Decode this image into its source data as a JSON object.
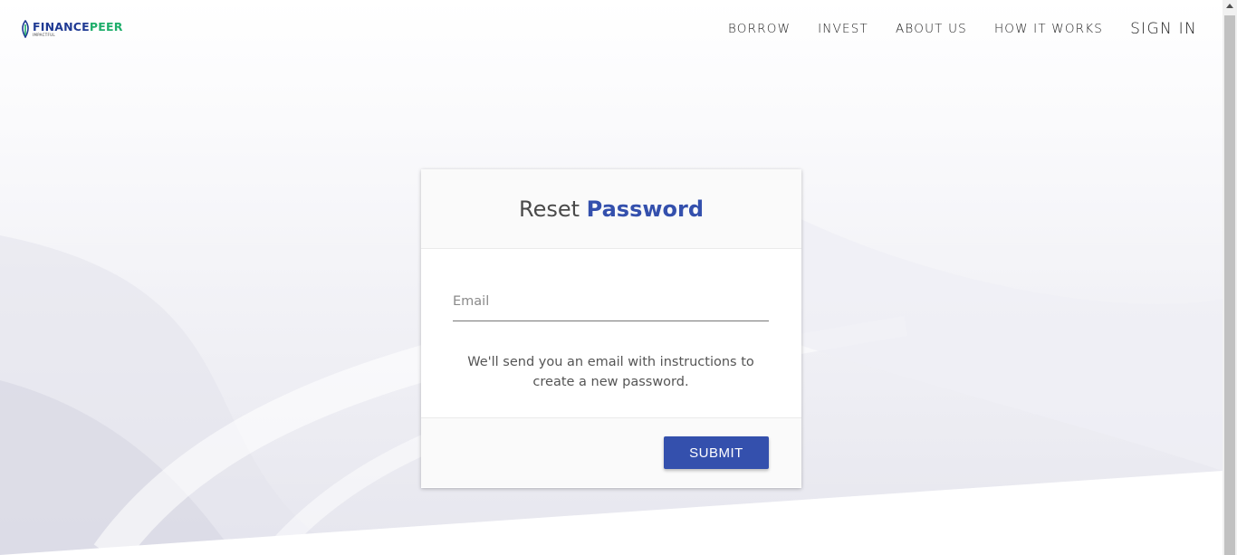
{
  "header": {
    "logo": {
      "brand_part1": "FINANCE",
      "brand_part2": "PEER",
      "tagline": "IMPACTFUL"
    },
    "nav": [
      {
        "label": "BORROW"
      },
      {
        "label": "INVEST"
      },
      {
        "label": "ABOUT US"
      },
      {
        "label": "HOW IT WORKS"
      },
      {
        "label": "SIGN IN"
      }
    ]
  },
  "card": {
    "title_plain": "Reset ",
    "title_accent": "Password",
    "email": {
      "placeholder": "Email",
      "value": ""
    },
    "hint": "We'll send you an email with instructions to create a new password.",
    "submit_label": "SUBMIT"
  },
  "colors": {
    "accent": "#3450ad",
    "brand_blue": "#1f3a93",
    "brand_green": "#1fae6b"
  }
}
